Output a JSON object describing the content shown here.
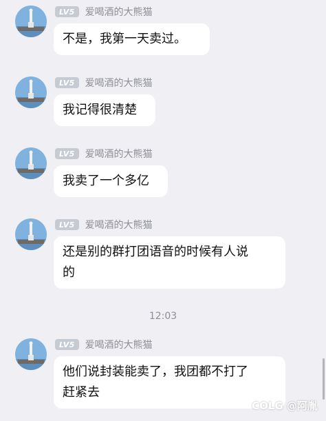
{
  "messages": [
    {
      "level": "LV5",
      "nickname": "爱喝酒的大熊猫",
      "text": "不是，我第一天卖过。"
    },
    {
      "level": "LV5",
      "nickname": "爱喝酒的大熊猫",
      "text": "我记得很清楚"
    },
    {
      "level": "LV5",
      "nickname": "爱喝酒的大熊猫",
      "text": "我卖了一个多亿"
    },
    {
      "level": "LV5",
      "nickname": "爱喝酒的大熊猫",
      "line1": "还是别的群打团语音的时候有人说",
      "line2": "的"
    },
    {
      "level": "LV5",
      "nickname": "爱喝酒的大熊猫",
      "line1": "他们说封装能卖了，我团都不打了",
      "line2": "赶紧去"
    }
  ],
  "timestamp": "12:03",
  "watermark": "COLG @阿胤",
  "colors": {
    "background": "#efeff4",
    "bubble": "#ffffff",
    "level_badge": "#c6cad3",
    "nickname": "#8d8f94"
  },
  "avatar_icon": "statue-on-pier-avatar"
}
